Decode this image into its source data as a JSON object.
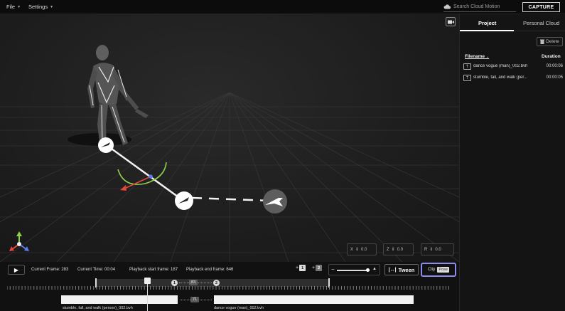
{
  "topbar": {
    "menus": [
      {
        "label": "File"
      },
      {
        "label": "Settings"
      }
    ],
    "search_placeholder": "Search Cloud Motion",
    "capture_label": "CAPTURE"
  },
  "viewport": {
    "coords": [
      {
        "axis": "X",
        "value": "0.0"
      },
      {
        "axis": "Z",
        "value": "0.0"
      },
      {
        "axis": "R",
        "value": "0.0"
      }
    ]
  },
  "panel": {
    "tabs": [
      {
        "label": "Project",
        "active": true
      },
      {
        "label": "Personal Cloud",
        "active": false
      }
    ],
    "delete_label": "Delete",
    "columns": {
      "filename": "Filename",
      "duration": "Duration"
    },
    "files": [
      {
        "name": "dance vogue (man)_002.bvh",
        "duration": "00:00:06"
      },
      {
        "name": "stumble, fall, and walk (per...",
        "duration": "00:00:05"
      }
    ]
  },
  "bottom": {
    "current_frame_label": "Current Frame: 283",
    "current_time_label": "Current Time: 00:04",
    "playback_start_label": "Playback start frame: 187",
    "playback_end_label": "Playback end frame: 646",
    "addkey1": "1",
    "addkey2": "2",
    "tween_label": "Tween",
    "clip_label": "Clip",
    "pose_label": "Pose",
    "marker1": "1",
    "marker_mid": "83",
    "marker2": "2",
    "transition_count": "71",
    "clip_labels": [
      "stumble, fall, and walk (person)_002.bvh",
      "dance vogue (man)_002.bvh"
    ]
  },
  "colors": {
    "accent": "#8d8cf0",
    "background": "#121212",
    "panel": "#141414"
  }
}
